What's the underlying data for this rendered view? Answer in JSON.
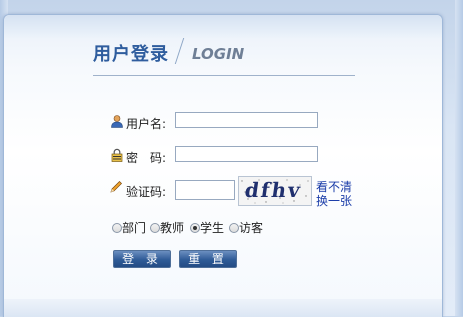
{
  "header": {
    "title_zh": "用户登录",
    "title_en": "LOGIN"
  },
  "form": {
    "username": {
      "label": "用户名:",
      "value": "",
      "icon": "user-icon"
    },
    "password": {
      "label": "密　码:",
      "value": "",
      "icon": "lock-icon"
    },
    "captcha": {
      "label": "验证码:",
      "value": "",
      "icon": "pencil-icon",
      "image_text": "dfhv",
      "refresh_label_line1": "看不清",
      "refresh_label_line2": "换一张"
    },
    "roles": [
      {
        "label": "部门",
        "checked": false
      },
      {
        "label": "教师",
        "checked": false
      },
      {
        "label": "学生",
        "checked": true
      },
      {
        "label": "访客",
        "checked": false
      }
    ],
    "buttons": {
      "login": "登 录",
      "reset": "重 置"
    }
  },
  "colors": {
    "accent": "#2f5d9e",
    "button": "#2f5b97",
    "link": "#1a3ca8"
  }
}
